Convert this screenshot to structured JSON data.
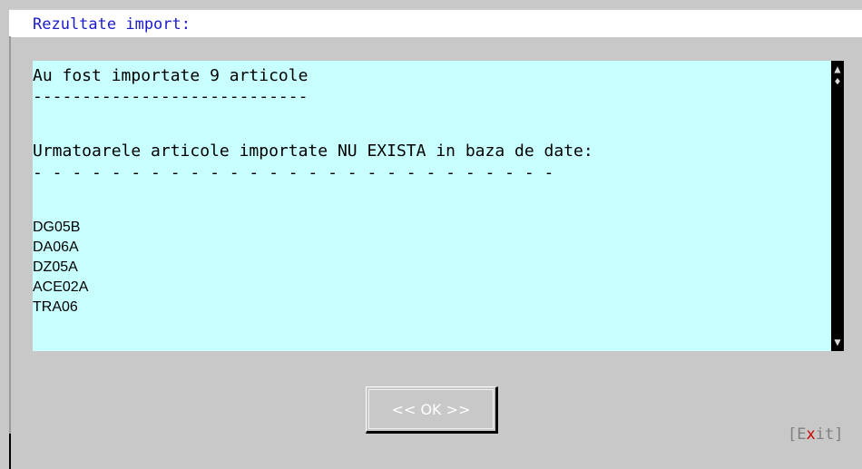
{
  "dialog": {
    "title": "Rezultate import:"
  },
  "results": {
    "line_1": "Au fost importate 9 articole",
    "separator_1": "----------------------------",
    "line_2": "Urmatoarele articole importate NU EXISTA in baza de date:",
    "separator_2": "- - - - - - - - - - - - - - - - - - - - - - - - - - -",
    "items": [
      "DG05B",
      "DA06A",
      "DZ05A",
      "ACE02A",
      "TRA06"
    ]
  },
  "scrollbar": {
    "up_glyph": "▲",
    "thumb_glyph": "♦",
    "down_glyph": "▼"
  },
  "buttons": {
    "ok_label": "<< OK >>",
    "exit_open": "[",
    "exit_pre": "E",
    "exit_hot": "x",
    "exit_post": "it",
    "exit_close": "]"
  },
  "colors": {
    "title": "#1a1acc",
    "text_area_bg": "#c8ffff",
    "dialog_bg": "#c8c8c8",
    "hotkey": "#cc0000"
  }
}
